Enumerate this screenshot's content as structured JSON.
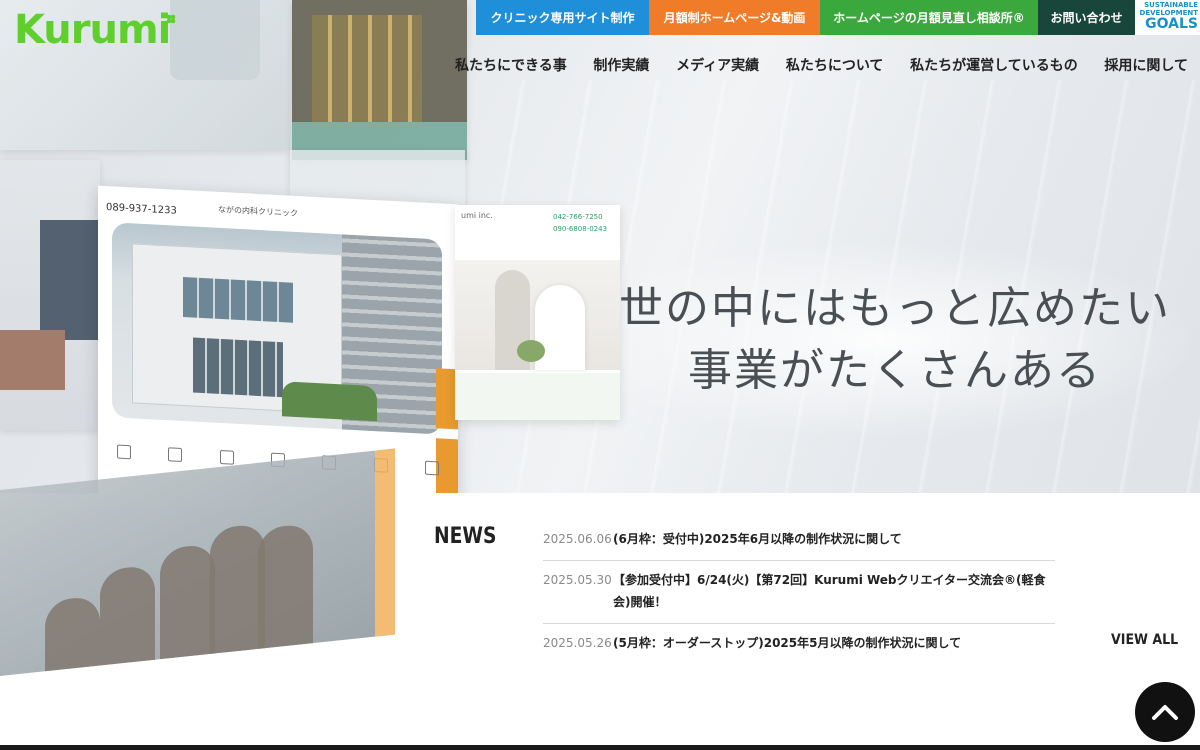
{
  "brand": {
    "logo_text": "Kurumi",
    "logo_color": "#5fcf2e"
  },
  "topbar": {
    "items": [
      {
        "label": "クリニック専用サイト制作",
        "color": "#1e8fd8"
      },
      {
        "label": "月額制ホームページ&動画",
        "color": "#f07b28"
      },
      {
        "label": "ホームページの月額見直し相談所®",
        "color": "#3aa83d"
      },
      {
        "label": "お問い合わせ",
        "color": "#19463a"
      }
    ],
    "sdgs": {
      "line1": "SUSTAINABLE",
      "line2": "DEVELOPMENT",
      "line3": "GOALS"
    }
  },
  "nav": {
    "items": [
      {
        "label": "私たちにできる事"
      },
      {
        "label": "制作実績"
      },
      {
        "label": "メディア実績"
      },
      {
        "label": "私たちについて"
      },
      {
        "label": "私たちが運営しているもの"
      },
      {
        "label": "採用に関して"
      }
    ]
  },
  "hero": {
    "catch_line1": "世の中にはもっと広めたい",
    "catch_line2": "事業がたくさんある",
    "mock_clinic": {
      "phone": "089-937-1233",
      "name": "ながの内科クリニック"
    },
    "mock_wedding": {
      "brand": "umi inc.",
      "phone1": "042-766-7250",
      "phone2": "090-6808-0243"
    }
  },
  "news": {
    "title": "NEWS",
    "items": [
      {
        "date": "2025.06.06",
        "text": "(6月枠：受付中)2025年6月以降の制作状況に関して"
      },
      {
        "date": "2025.05.30",
        "text": "【参加受付中】6/24(火)【第72回】Kurumi Webクリエイター交流会®(軽食会)開催！"
      },
      {
        "date": "2025.05.26",
        "text": "(5月枠：オーダーストップ)2025年5月以降の制作状況に関して"
      }
    ],
    "view_all": "VIEW ALL"
  },
  "page_top": {
    "icon": "chevron-up-icon"
  }
}
